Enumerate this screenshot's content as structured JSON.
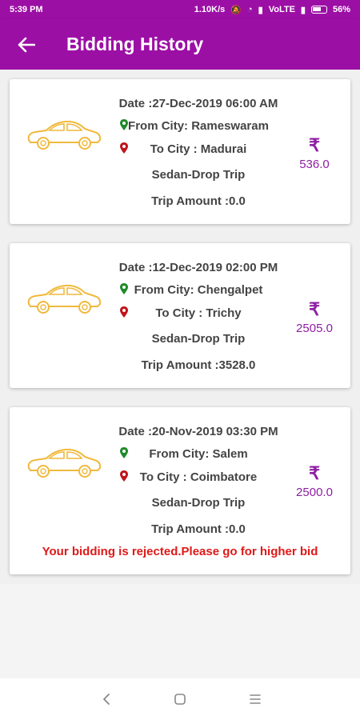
{
  "status_bar": {
    "time": "5:39 PM",
    "speed": "1.10K/s",
    "network": "VoLTE",
    "battery": "56%"
  },
  "app_bar": {
    "title": "Bidding History",
    "back_icon": "arrow-left-icon"
  },
  "colors": {
    "primary": "#9c0fa5",
    "amount": "#8e1fa3",
    "from_pin": "#1f8a2a",
    "to_pin": "#c0141b",
    "rejected": "#e01818",
    "car": "#f0b93c"
  },
  "bids": [
    {
      "date": "Date :27-Dec-2019 06:00 AM",
      "from": "From City: Rameswaram",
      "to": "To City : Madurai",
      "trip_type": "Sedan-Drop Trip",
      "trip_amount": "Trip Amount :0.0",
      "currency": "₹",
      "bid_amount": "536.0",
      "status": ""
    },
    {
      "date": "Date :12-Dec-2019 02:00 PM",
      "from": "From City: Chengalpet",
      "to": "To City : Trichy",
      "trip_type": "Sedan-Drop Trip",
      "trip_amount": "Trip Amount :3528.0",
      "currency": "₹",
      "bid_amount": "2505.0",
      "status": ""
    },
    {
      "date": "Date :20-Nov-2019 03:30 PM",
      "from": "From City: Salem",
      "to": "To City : Coimbatore",
      "trip_type": "Sedan-Drop Trip",
      "trip_amount": "Trip Amount :0.0",
      "currency": "₹",
      "bid_amount": "2500.0",
      "status": "Your bidding is rejected.Please go for higher bid"
    }
  ],
  "nav": {
    "back": "nav-back-icon",
    "home": "nav-home-icon",
    "recents": "nav-menu-icon"
  }
}
